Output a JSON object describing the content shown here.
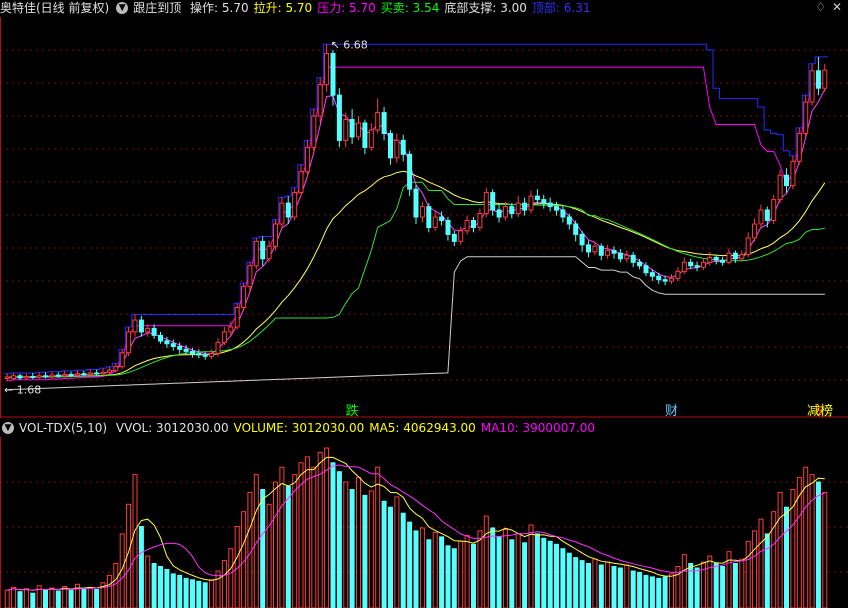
{
  "header": {
    "title": "奥特佳(日线 前复权)",
    "indicator": "跟庄到顶",
    "items": [
      {
        "label": "操作:",
        "value": "5.70",
        "color": "#e0e0e0"
      },
      {
        "label": "拉升:",
        "value": "5.70",
        "color": "#ffff00"
      },
      {
        "label": "压力:",
        "value": "5.70",
        "color": "#ff00ff"
      },
      {
        "label": "买卖:",
        "value": "3.54",
        "color": "#00ff00"
      },
      {
        "label": "底部支撑:",
        "value": "3.00",
        "color": "#e0e0e0"
      },
      {
        "label": "顶部:",
        "value": "6.31",
        "color": "#3030ff"
      }
    ]
  },
  "price_chart": {
    "high_label": "6.68",
    "low_label": "1.68",
    "markers": [
      {
        "text": "跌",
        "color": "#00ff00"
      },
      {
        "text": "财",
        "color": "#5fc8ff"
      },
      {
        "text": "$",
        "color": "#ff3030"
      },
      {
        "text": "减榜",
        "color": "#ffff00"
      }
    ],
    "ylim": [
      1.5,
      6.9
    ],
    "candles": [
      [
        1.88,
        1.9,
        1.95,
        1.84
      ],
      [
        1.88,
        1.92,
        1.96,
        1.85
      ],
      [
        1.92,
        1.89,
        1.95,
        1.86
      ],
      [
        1.89,
        1.91,
        1.95,
        1.86
      ],
      [
        1.91,
        1.9,
        1.96,
        1.87
      ],
      [
        1.9,
        1.92,
        1.97,
        1.87
      ],
      [
        1.92,
        1.91,
        1.97,
        1.88
      ],
      [
        1.91,
        1.93,
        1.98,
        1.88
      ],
      [
        1.93,
        1.92,
        1.97,
        1.89
      ],
      [
        1.92,
        1.94,
        1.99,
        1.89
      ],
      [
        1.94,
        1.93,
        1.98,
        1.9
      ],
      [
        1.93,
        1.95,
        2.0,
        1.9
      ],
      [
        1.95,
        1.94,
        1.99,
        1.91
      ],
      [
        1.94,
        1.96,
        2.01,
        1.91
      ],
      [
        1.96,
        1.95,
        2.01,
        1.92
      ],
      [
        1.95,
        1.97,
        2.03,
        1.92
      ],
      [
        1.97,
        2.0,
        2.05,
        1.94
      ],
      [
        2.0,
        2.05,
        2.1,
        1.97
      ],
      [
        2.05,
        2.25,
        2.3,
        2.02
      ],
      [
        2.25,
        2.55,
        2.62,
        2.2
      ],
      [
        2.55,
        2.72,
        2.8,
        2.48
      ],
      [
        2.72,
        2.55,
        2.78,
        2.48
      ],
      [
        2.55,
        2.6,
        2.66,
        2.48
      ],
      [
        2.6,
        2.5,
        2.66,
        2.45
      ],
      [
        2.5,
        2.42,
        2.55,
        2.38
      ],
      [
        2.42,
        2.38,
        2.48,
        2.32
      ],
      [
        2.38,
        2.34,
        2.44,
        2.28
      ],
      [
        2.34,
        2.3,
        2.4,
        2.24
      ],
      [
        2.3,
        2.27,
        2.36,
        2.22
      ],
      [
        2.27,
        2.24,
        2.32,
        2.18
      ],
      [
        2.24,
        2.22,
        2.3,
        2.17
      ],
      [
        2.22,
        2.2,
        2.27,
        2.15
      ],
      [
        2.2,
        2.24,
        2.3,
        2.16
      ],
      [
        2.24,
        2.4,
        2.46,
        2.2
      ],
      [
        2.4,
        2.55,
        2.62,
        2.36
      ],
      [
        2.55,
        2.62,
        2.7,
        2.5
      ],
      [
        2.62,
        2.9,
        2.96,
        2.58
      ],
      [
        2.9,
        3.2,
        3.25,
        2.85
      ],
      [
        3.2,
        3.5,
        3.55,
        3.12
      ],
      [
        3.5,
        3.85,
        3.9,
        3.45
      ],
      [
        3.85,
        3.6,
        3.92,
        3.5
      ],
      [
        3.6,
        3.78,
        3.86,
        3.55
      ],
      [
        3.78,
        4.1,
        4.16,
        3.72
      ],
      [
        4.1,
        4.4,
        4.48,
        4.02
      ],
      [
        4.4,
        4.2,
        4.5,
        4.1
      ],
      [
        4.2,
        4.55,
        4.62,
        4.15
      ],
      [
        4.55,
        4.85,
        4.95,
        4.5
      ],
      [
        4.85,
        5.2,
        5.3,
        4.78
      ],
      [
        5.2,
        5.65,
        5.75,
        5.12
      ],
      [
        5.65,
        6.1,
        6.2,
        5.55
      ],
      [
        6.1,
        6.55,
        6.68,
        6.0
      ],
      [
        6.55,
        5.95,
        6.6,
        5.8
      ],
      [
        5.95,
        5.3,
        6.05,
        5.2
      ],
      [
        5.3,
        5.6,
        5.7,
        5.2
      ],
      [
        5.6,
        5.35,
        5.75,
        5.25
      ],
      [
        5.35,
        5.55,
        5.65,
        5.3
      ],
      [
        5.55,
        5.2,
        5.6,
        5.1
      ],
      [
        5.2,
        5.45,
        5.55,
        5.15
      ],
      [
        5.45,
        5.7,
        5.9,
        5.4
      ],
      [
        5.7,
        5.4,
        5.78,
        5.3
      ],
      [
        5.4,
        5.05,
        5.45,
        4.95
      ],
      [
        5.05,
        5.3,
        5.4,
        4.98
      ],
      [
        5.3,
        5.1,
        5.38,
        5.0
      ],
      [
        5.1,
        4.6,
        5.15,
        4.5
      ],
      [
        4.6,
        4.2,
        4.66,
        4.1
      ],
      [
        4.2,
        4.35,
        4.42,
        4.12
      ],
      [
        4.35,
        4.05,
        4.4,
        3.98
      ],
      [
        4.05,
        4.2,
        4.28,
        4.0
      ],
      [
        4.2,
        4.15,
        4.28,
        4.08
      ],
      [
        4.15,
        3.95,
        4.2,
        3.86
      ],
      [
        3.95,
        3.85,
        4.0,
        3.78
      ],
      [
        3.85,
        4.0,
        4.06,
        3.8
      ],
      [
        4.0,
        4.15,
        4.22,
        3.95
      ],
      [
        4.15,
        4.05,
        4.2,
        3.98
      ],
      [
        4.05,
        4.25,
        4.32,
        4.0
      ],
      [
        4.25,
        4.55,
        4.62,
        4.2
      ],
      [
        4.55,
        4.3,
        4.6,
        4.22
      ],
      [
        4.3,
        4.2,
        4.38,
        4.12
      ],
      [
        4.2,
        4.35,
        4.42,
        4.15
      ],
      [
        4.35,
        4.25,
        4.4,
        4.18
      ],
      [
        4.25,
        4.4,
        4.5,
        4.2
      ],
      [
        4.4,
        4.3,
        4.48,
        4.22
      ],
      [
        4.3,
        4.5,
        4.58,
        4.25
      ],
      [
        4.5,
        4.45,
        4.6,
        4.38
      ],
      [
        4.45,
        4.4,
        4.52,
        4.32
      ],
      [
        4.4,
        4.35,
        4.48,
        4.28
      ],
      [
        4.35,
        4.3,
        4.42,
        4.22
      ],
      [
        4.3,
        4.2,
        4.35,
        4.12
      ],
      [
        4.2,
        4.1,
        4.25,
        4.02
      ],
      [
        4.1,
        3.95,
        4.15,
        3.85
      ],
      [
        3.95,
        3.8,
        4.0,
        3.7
      ],
      [
        3.8,
        3.7,
        3.86,
        3.62
      ],
      [
        3.7,
        3.78,
        3.85,
        3.65
      ],
      [
        3.78,
        3.65,
        3.82,
        3.58
      ],
      [
        3.65,
        3.72,
        3.8,
        3.6
      ],
      [
        3.72,
        3.68,
        3.78,
        3.6
      ],
      [
        3.68,
        3.6,
        3.74,
        3.55
      ],
      [
        3.6,
        3.65,
        3.72,
        3.55
      ],
      [
        3.65,
        3.55,
        3.7,
        3.48
      ],
      [
        3.55,
        3.5,
        3.6,
        3.45
      ],
      [
        3.5,
        3.4,
        3.55,
        3.35
      ],
      [
        3.4,
        3.35,
        3.45,
        3.28
      ],
      [
        3.35,
        3.3,
        3.4,
        3.24
      ],
      [
        3.3,
        3.28,
        3.36,
        3.22
      ],
      [
        3.28,
        3.32,
        3.38,
        3.24
      ],
      [
        3.32,
        3.42,
        3.48,
        3.28
      ],
      [
        3.42,
        3.55,
        3.62,
        3.38
      ],
      [
        3.55,
        3.5,
        3.6,
        3.45
      ],
      [
        3.5,
        3.48,
        3.56,
        3.42
      ],
      [
        3.48,
        3.55,
        3.6,
        3.44
      ],
      [
        3.55,
        3.62,
        3.7,
        3.5
      ],
      [
        3.62,
        3.58,
        3.66,
        3.52
      ],
      [
        3.58,
        3.55,
        3.63,
        3.5
      ],
      [
        3.55,
        3.68,
        3.75,
        3.52
      ],
      [
        3.68,
        3.6,
        3.72,
        3.54
      ],
      [
        3.6,
        3.66,
        3.72,
        3.56
      ],
      [
        3.66,
        3.9,
        3.98,
        3.62
      ],
      [
        3.9,
        4.1,
        4.18,
        3.85
      ],
      [
        4.1,
        4.3,
        4.38,
        4.05
      ],
      [
        4.3,
        4.15,
        4.35,
        4.05
      ],
      [
        4.15,
        4.45,
        4.52,
        4.1
      ],
      [
        4.45,
        4.8,
        4.88,
        4.4
      ],
      [
        4.8,
        4.65,
        4.9,
        4.55
      ],
      [
        4.65,
        5.0,
        5.08,
        4.6
      ],
      [
        5.0,
        5.4,
        5.48,
        4.95
      ],
      [
        5.4,
        5.85,
        5.95,
        5.35
      ],
      [
        5.85,
        6.3,
        6.4,
        5.8
      ],
      [
        6.3,
        6.05,
        6.5,
        5.95
      ],
      [
        6.05,
        6.31,
        6.4,
        6.0
      ]
    ]
  },
  "volume_header": {
    "name": "VOL-TDX(5,10)",
    "items": [
      {
        "label": "VVOL:",
        "value": "3012030.00",
        "color": "#e0e0e0"
      },
      {
        "label": "VOLUME:",
        "value": "3012030.00",
        "color": "#ffff00"
      },
      {
        "label": "MA5:",
        "value": "4062943.00",
        "color": "#ffff00"
      },
      {
        "label": "MA10:",
        "value": "3900007.00",
        "color": "#ff00ff"
      }
    ]
  },
  "volume_chart": {
    "ylim": [
      0,
      11000000
    ],
    "values": [
      1200000,
      1400000,
      1100000,
      1300000,
      1000000,
      1500000,
      1250000,
      1350000,
      1150000,
      1450000,
      1200000,
      1600000,
      1300000,
      1400000,
      1250000,
      1700000,
      2200000,
      3000000,
      5000000,
      7000000,
      9000000,
      5500000,
      3500000,
      3000000,
      2800000,
      2600000,
      2300000,
      2200000,
      2000000,
      1900000,
      1800000,
      1700000,
      1900000,
      2500000,
      3200000,
      4000000,
      5500000,
      6500000,
      7800000,
      9000000,
      8000000,
      7000000,
      8500000,
      9500000,
      8200000,
      9000000,
      9800000,
      10200000,
      9500000,
      10500000,
      10800000,
      9800000,
      9200000,
      8500000,
      8000000,
      8800000,
      7600000,
      7900000,
      9500000,
      7200000,
      6800000,
      7500000,
      6400000,
      5800000,
      5200000,
      5400000,
      4600000,
      5100000,
      4800000,
      4200000,
      4000000,
      4500000,
      4900000,
      4300000,
      5200000,
      6200000,
      5400000,
      4800000,
      5300000,
      4600000,
      5000000,
      4400000,
      5600000,
      5000000,
      4700000,
      4500000,
      4300000,
      4000000,
      3700000,
      3400000,
      3200000,
      3000000,
      3300000,
      2900000,
      3100000,
      2800000,
      2700000,
      2900000,
      2500000,
      2400000,
      2200000,
      2100000,
      2000000,
      2100000,
      2300000,
      2800000,
      3600000,
      3000000,
      2700000,
      3100000,
      3500000,
      3000000,
      2800000,
      3800000,
      3000000,
      3300000,
      4500000,
      5200000,
      6000000,
      5000000,
      6500000,
      7800000,
      6800000,
      8000000,
      8800000,
      9500000,
      9000000,
      8500000,
      7800000
    ],
    "ma_white": [],
    "ma_yellow": [],
    "ma_magenta": []
  }
}
